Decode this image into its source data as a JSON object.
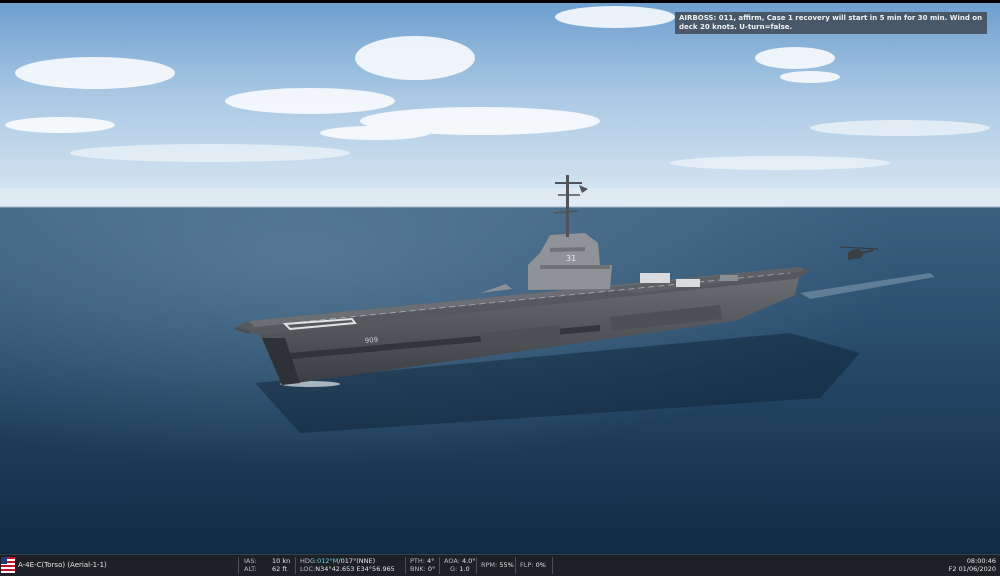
{
  "chat": {
    "message": "AIRBOSS: 011, affirm, Case 1 recovery will start in 5 min for 30 min. Wind on deck 20 knots. U-turn=false."
  },
  "ship": {
    "hull_number": "31"
  },
  "status_bar": {
    "unit": "A-4E-C(Torso) (Aerial-1-1)",
    "ias_label": "IAS:",
    "ias_value": "10 kn",
    "alt_label": "ALT:",
    "alt_value": "62 ft",
    "hdg_label": "HDG:",
    "hdg_mag": "012°M",
    "hdg_true": "/017°(NNE)",
    "loc_label": "LOC:",
    "loc_value": "N34°42.653 E34°56.965",
    "pth_label": "PTH:",
    "pth_value": "4°",
    "bnk_label": "BNK:",
    "bnk_value": "0°",
    "aoa_label": "AOA:",
    "aoa_value": "4.0°",
    "g_label": "G:",
    "g_value": "1.0",
    "rpm_label": "RPM:",
    "rpm_value": "55%",
    "flp_label": "FLP:",
    "flp_value": "0%",
    "time": "08:00:46",
    "date": "F2 01/06/2020"
  },
  "colors": {
    "accent": "#66d2f2",
    "bar_bg": "#1d2126"
  }
}
